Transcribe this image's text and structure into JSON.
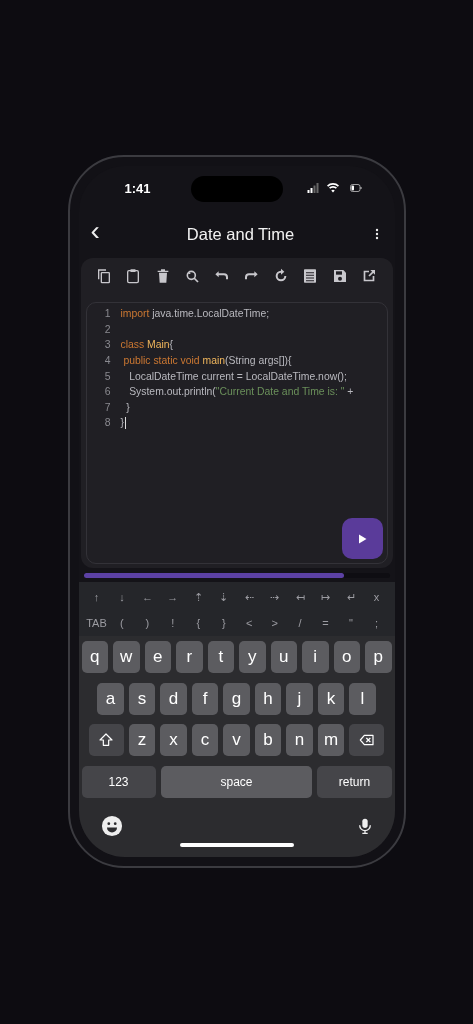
{
  "status_bar": {
    "time": "1:41"
  },
  "app_bar": {
    "title": "Date and Time",
    "back": "‹"
  },
  "code_editor": {
    "lines": [
      {
        "number": "1",
        "tokens": [
          {
            "kind": "keyword",
            "text": "import "
          },
          {
            "kind": "plain",
            "text": "java.time.LocalDateTime;"
          }
        ]
      },
      {
        "number": "2"
      },
      {
        "number": "3",
        "tokens": [
          {
            "kind": "keyword",
            "text": "class "
          },
          {
            "kind": "name",
            "text": "Main"
          },
          {
            "kind": "plain",
            "text": "{"
          }
        ]
      },
      {
        "number": "4",
        "tokens": [
          {
            "kind": "keyword",
            "text": " public static void "
          },
          {
            "kind": "name",
            "text": "main"
          },
          {
            "kind": "plain",
            "text": "(String args[]){"
          }
        ]
      },
      {
        "number": "5",
        "tokens": [
          {
            "kind": "plain",
            "text": "   LocalDateTime current = LocalDateTime.now();"
          }
        ]
      },
      {
        "number": "6",
        "tokens": [
          {
            "kind": "plain",
            "text": "   System.out.println("
          },
          {
            "kind": "string",
            "text": "\"Current Date and Time is: \""
          },
          {
            "kind": "plain",
            "text": " +"
          }
        ]
      },
      {
        "number": "7",
        "tokens": [
          {
            "kind": "plain",
            "text": "  }"
          }
        ]
      },
      {
        "number": "8",
        "tokens": [
          {
            "kind": "plain",
            "text": "}"
          }
        ],
        "cursor": true
      }
    ]
  },
  "extra_keys": [
    [
      "↑",
      "↓",
      "←",
      "→",
      "⇡",
      "⇣",
      "⇠",
      "⇢",
      "↤",
      "↦",
      "↵",
      "x"
    ],
    [
      "TAB",
      "(",
      ")",
      "!",
      "{",
      "}",
      "<",
      ">",
      "/",
      "=",
      "\"",
      ";"
    ]
  ],
  "keyboard": {
    "rows": [
      {
        "keys": [
          {
            "kind": "letter",
            "label": "q"
          },
          {
            "kind": "letter",
            "label": "w"
          },
          {
            "kind": "letter",
            "label": "e"
          },
          {
            "kind": "letter",
            "label": "r"
          },
          {
            "kind": "letter",
            "label": "t"
          },
          {
            "kind": "letter",
            "label": "y"
          },
          {
            "kind": "letter",
            "label": "u"
          },
          {
            "kind": "letter",
            "label": "i"
          },
          {
            "kind": "letter",
            "label": "o"
          },
          {
            "kind": "letter",
            "label": "p"
          }
        ]
      },
      {
        "keys": [
          {
            "kind": "letter",
            "label": "a"
          },
          {
            "kind": "letter",
            "label": "s"
          },
          {
            "kind": "letter",
            "label": "d"
          },
          {
            "kind": "letter",
            "label": "f"
          },
          {
            "kind": "letter",
            "label": "g"
          },
          {
            "kind": "letter",
            "label": "h"
          },
          {
            "kind": "letter",
            "label": "j"
          },
          {
            "kind": "letter",
            "label": "k"
          },
          {
            "kind": "letter",
            "label": "l"
          }
        ]
      },
      {
        "keys": [
          {
            "kind": "shift"
          },
          {
            "kind": "letter",
            "label": "z"
          },
          {
            "kind": "letter",
            "label": "x"
          },
          {
            "kind": "letter",
            "label": "c"
          },
          {
            "kind": "letter",
            "label": "v"
          },
          {
            "kind": "letter",
            "label": "b"
          },
          {
            "kind": "letter",
            "label": "n"
          },
          {
            "kind": "letter",
            "label": "m"
          },
          {
            "kind": "backspace"
          }
        ]
      },
      {
        "keys": [
          {
            "kind": "numbers",
            "label": "123"
          },
          {
            "kind": "space",
            "label": "space"
          },
          {
            "kind": "return",
            "label": "return"
          }
        ]
      }
    ]
  }
}
